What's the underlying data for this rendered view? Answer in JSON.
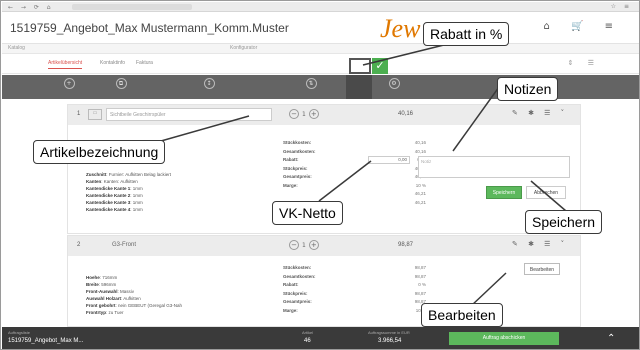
{
  "header": {
    "title": "1519759_Angebot_Max Mustermann_Komm.Muster",
    "logo": "Jew",
    "sub_left": "Katalog",
    "sub_mid": "Konfigurator"
  },
  "tabs": [
    {
      "label": "Artikelübersicht"
    },
    {
      "label": "Kontaktinfo"
    },
    {
      "label": "Faktura"
    }
  ],
  "toolbar": {
    "rabatt_active_label": "Rabatt in %"
  },
  "articles": [
    {
      "number": "1",
      "name_placeholder": "Sichtbeile Geschirrspüler",
      "price": "40,16",
      "props": [
        {
          "key": "Zuschnitt",
          "val": "Furnier: Aufkitten Belag lackiert"
        },
        {
          "key": "Kanten",
          "val": "Kanten: Aufkitten"
        },
        {
          "key": "Kantendicke Kante 1",
          "val": "1mm"
        },
        {
          "key": "Kantendicke Kante 2",
          "val": "1mm"
        },
        {
          "key": "Kantendicke Kante 3",
          "val": "1mm"
        },
        {
          "key": "Kantendicke Kante 4",
          "val": "1mm"
        }
      ],
      "price_labels": [
        "Stückkosten:",
        "Gesamtkosten:",
        "Rabatt:",
        "Stückpreis:",
        "Gesamtpreis:",
        "Marge:"
      ],
      "price_values": [
        "40,16",
        "40,16",
        "0,00",
        "40,16",
        "40,16",
        "10 %",
        "46,21",
        "46,21"
      ],
      "rabatt_value": "0,00",
      "notes_placeholder": "Notiz",
      "save_label": "Speichern",
      "cancel_label": "Abbrechen"
    },
    {
      "number": "2",
      "name": "G3-Front",
      "price": "98,87",
      "props": [
        {
          "key": "Hoehe",
          "val": "716mm"
        },
        {
          "key": "Breite",
          "val": "596mm"
        },
        {
          "key": "Front-Auswahl",
          "val": "Massiv"
        },
        {
          "key": "Auswahl Holzart",
          "val": "Aufkitten"
        },
        {
          "key": "Front gebohrt",
          "val": "nein GEBEUT (Geregal G3-Nah"
        },
        {
          "key": "Frontrtyp",
          "val": "zu Tuer"
        }
      ],
      "price_labels": [
        "Stückkosten:",
        "Gesamtkosten:",
        "Rabatt:",
        "Stückpreis:",
        "Gesamtpreis:",
        "Marge:"
      ],
      "price_values": [
        "98,87",
        "98,87",
        "0 %",
        "98,87",
        "98,87",
        "10 %"
      ],
      "edit_label": "Bearbeiten"
    }
  ],
  "footer": {
    "project_label": "Auftragsliste",
    "project_value": "1519759_Angebot_Max M...",
    "qty_label": "Artikel",
    "qty_value": "46",
    "total_label": "Auftragssumme in EUR",
    "total_value": "3.966,54",
    "order_button": "Auftrag abschicken"
  },
  "callouts": {
    "rabatt": "Rabatt in %",
    "notizen": "Notizen",
    "artikelbezeichnung": "Artikelbezeichnung",
    "vknetto": "VK-Netto",
    "speichern": "Speichern",
    "bearbeiten": "Bearbeiten"
  }
}
